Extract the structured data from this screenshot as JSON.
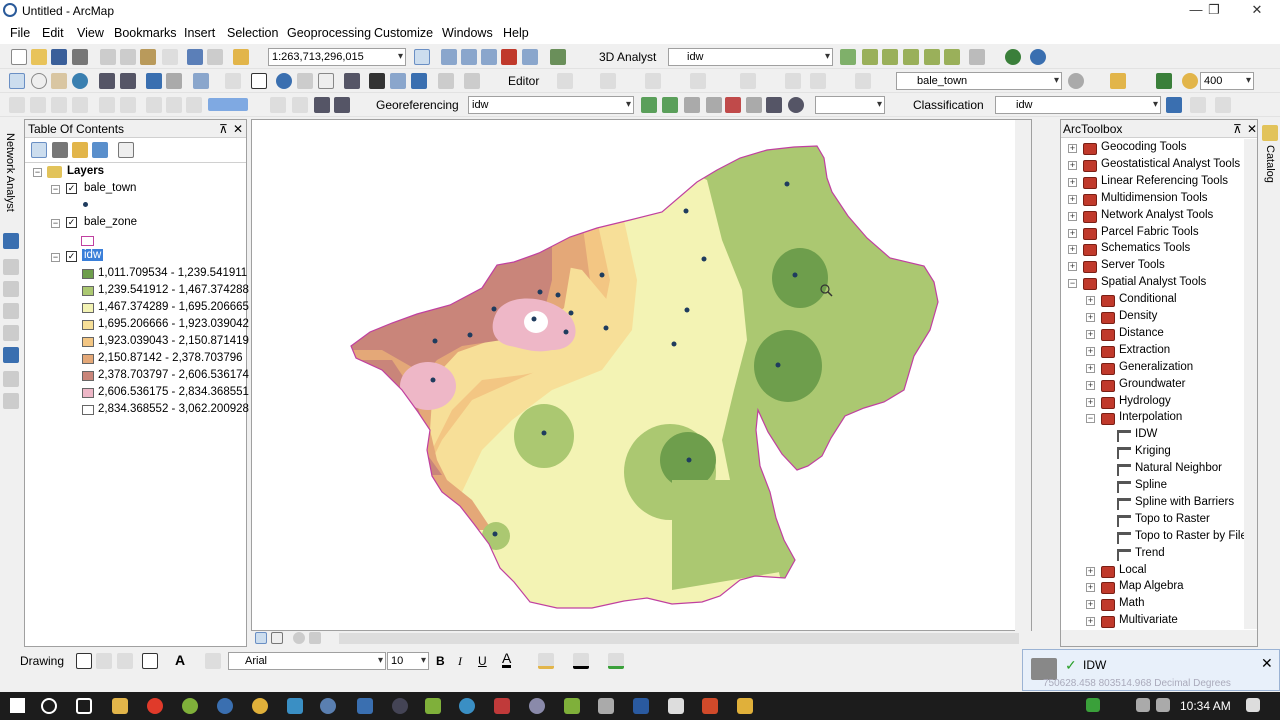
{
  "window": {
    "title": "Untitled - ArcMap",
    "minimize": "—",
    "restore": "❐",
    "close": "✕"
  },
  "menu": [
    "File",
    "Edit",
    "View",
    "Bookmarks",
    "Insert",
    "Selection",
    "Geoprocessing",
    "Customize",
    "Windows",
    "Help"
  ],
  "toolbar1": {
    "scale": "1:263,713,296,015",
    "analyst_label": "3D Analyst",
    "analyst_layer": "idw"
  },
  "toolbar2": {
    "editor_label": "Editor",
    "layer": "bale_town",
    "zoom": "400"
  },
  "toolbar3": {
    "georef_label": "Georeferencing",
    "georef_layer": "idw",
    "classification_label": "Classification",
    "classification_layer": "idw"
  },
  "leftstrip_label": "Network Analyst",
  "rightstrip_label": "Catalog",
  "toc": {
    "title": "Table Of Contents",
    "pin": "⊼",
    "close": "✕",
    "root": "Layers",
    "layers": [
      {
        "name": "bale_town"
      },
      {
        "name": "bale_zone"
      },
      {
        "name": "idw"
      }
    ],
    "classes": [
      {
        "label": "1,011.709534 - 1,239.541911",
        "color": "#6e9e4c"
      },
      {
        "label": "1,239.541912 - 1,467.374288",
        "color": "#abc871"
      },
      {
        "label": "1,467.374289 - 1,695.206665",
        "color": "#f3f3b4"
      },
      {
        "label": "1,695.206666 - 1,923.039042",
        "color": "#f7df98"
      },
      {
        "label": "1,923.039043 - 2,150.871419",
        "color": "#f3c683"
      },
      {
        "label": "2,150.87142 - 2,378.703796",
        "color": "#e4a878"
      },
      {
        "label": "2,378.703797 - 2,606.536174",
        "color": "#c9857a"
      },
      {
        "label": "2,606.536175 - 2,834.368551",
        "color": "#eeb7c7"
      },
      {
        "label": "2,834.368552 - 3,062.200928",
        "color": "#ffffff"
      }
    ]
  },
  "toolbox": {
    "title": "ArcToolbox",
    "items": [
      {
        "label": "Geocoding Tools",
        "level": 0,
        "exp": "+"
      },
      {
        "label": "Geostatistical Analyst Tools",
        "level": 0,
        "exp": "+"
      },
      {
        "label": "Linear Referencing Tools",
        "level": 0,
        "exp": "+"
      },
      {
        "label": "Multidimension Tools",
        "level": 0,
        "exp": "+"
      },
      {
        "label": "Network Analyst Tools",
        "level": 0,
        "exp": "+"
      },
      {
        "label": "Parcel Fabric Tools",
        "level": 0,
        "exp": "+"
      },
      {
        "label": "Schematics Tools",
        "level": 0,
        "exp": "+"
      },
      {
        "label": "Server Tools",
        "level": 0,
        "exp": "+"
      },
      {
        "label": "Spatial Analyst Tools",
        "level": 0,
        "exp": "−"
      },
      {
        "label": "Conditional",
        "level": 1,
        "exp": "+"
      },
      {
        "label": "Density",
        "level": 1,
        "exp": "+"
      },
      {
        "label": "Distance",
        "level": 1,
        "exp": "+"
      },
      {
        "label": "Extraction",
        "level": 1,
        "exp": "+"
      },
      {
        "label": "Generalization",
        "level": 1,
        "exp": "+"
      },
      {
        "label": "Groundwater",
        "level": 1,
        "exp": "+"
      },
      {
        "label": "Hydrology",
        "level": 1,
        "exp": "+"
      },
      {
        "label": "Interpolation",
        "level": 1,
        "exp": "−"
      },
      {
        "label": "IDW",
        "level": 2,
        "exp": ""
      },
      {
        "label": "Kriging",
        "level": 2,
        "exp": ""
      },
      {
        "label": "Natural Neighbor",
        "level": 2,
        "exp": ""
      },
      {
        "label": "Spline",
        "level": 2,
        "exp": ""
      },
      {
        "label": "Spline with Barriers",
        "level": 2,
        "exp": ""
      },
      {
        "label": "Topo to Raster",
        "level": 2,
        "exp": ""
      },
      {
        "label": "Topo to Raster by File",
        "level": 2,
        "exp": ""
      },
      {
        "label": "Trend",
        "level": 2,
        "exp": ""
      },
      {
        "label": "Local",
        "level": 1,
        "exp": "+"
      },
      {
        "label": "Map Algebra",
        "level": 1,
        "exp": "+"
      },
      {
        "label": "Math",
        "level": 1,
        "exp": "+"
      },
      {
        "label": "Multivariate",
        "level": 1,
        "exp": "+"
      }
    ]
  },
  "drawing": {
    "label": "Drawing",
    "font": "Arial",
    "size": "10",
    "bold": "B",
    "italic": "I",
    "underline": "U",
    "fontcolor": "A"
  },
  "notification": {
    "title": "IDW",
    "coords": "750628.458  803514.968 Decimal Degrees"
  },
  "taskbar": {
    "clock": "10:34 AM"
  }
}
